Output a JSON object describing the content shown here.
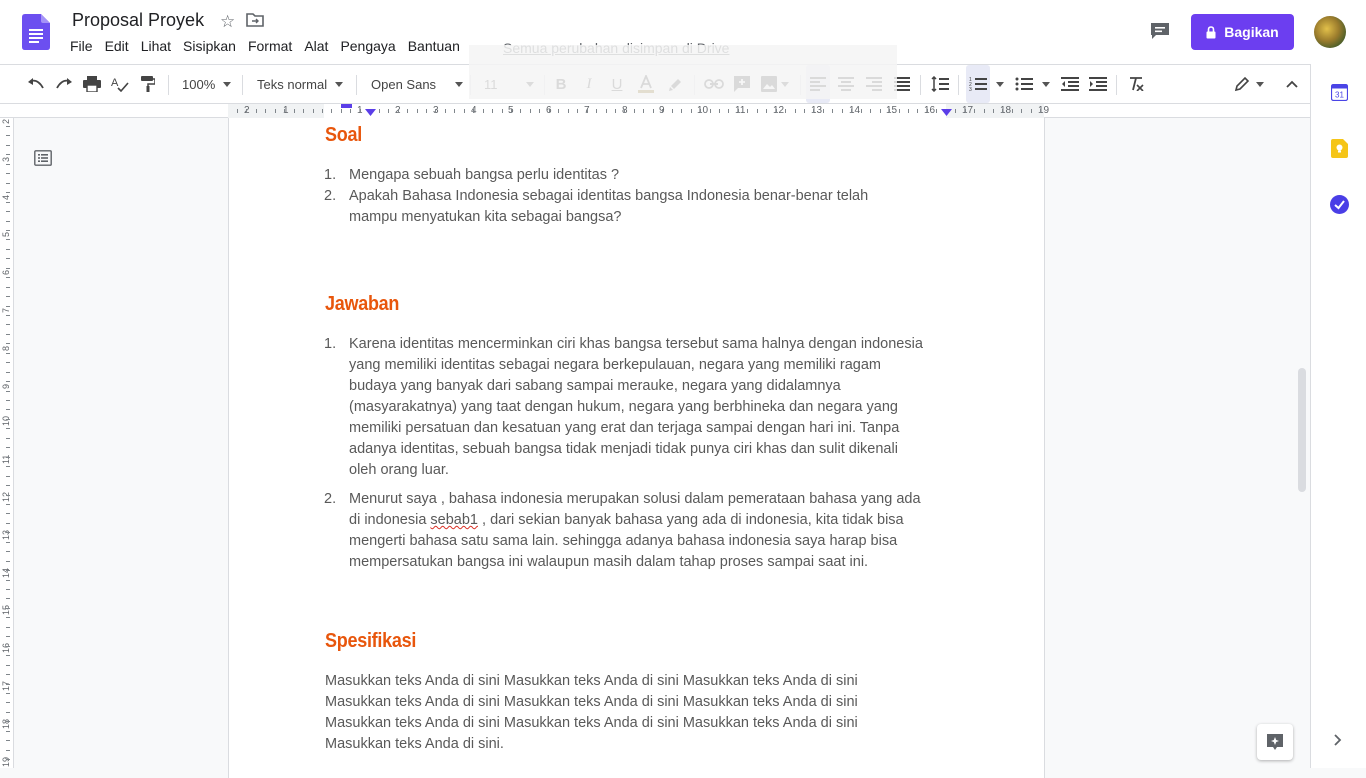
{
  "header": {
    "doc_title": "Proposal Proyek",
    "menu": [
      "File",
      "Edit",
      "Lihat",
      "Sisipkan",
      "Format",
      "Alat",
      "Pengaya",
      "Bantuan"
    ],
    "save_status": "Semua perubahan disimpan di Drive",
    "share_label": "Bagikan"
  },
  "toolbar": {
    "zoom": "100%",
    "style": "Teks normal",
    "font": "Open Sans",
    "size": "11"
  },
  "ruler": {
    "numbers": [
      "2",
      "1",
      "1",
      "2",
      "3",
      "4",
      "5",
      "6",
      "7",
      "8",
      "9",
      "10",
      "11",
      "12",
      "13",
      "14",
      "15",
      "16",
      "17",
      "18",
      "19"
    ]
  },
  "vruler": {
    "numbers": [
      "2",
      "3",
      "4",
      "5",
      "6",
      "7",
      "8",
      "9",
      "10",
      "11",
      "12",
      "13",
      "14",
      "15",
      "16",
      "17",
      "18",
      "19"
    ]
  },
  "document": {
    "soal_heading": "Soal",
    "soal_items": [
      {
        "num": "1.",
        "text": "Mengapa sebuah bangsa perlu identitas ?"
      },
      {
        "num": "2.",
        "text": "Apakah Bahasa Indonesia sebagai identitas bangsa Indonesia benar-benar telah mampu menyatukan kita sebagai bangsa?"
      }
    ],
    "jawaban_heading": "Jawaban",
    "jawaban_items": [
      {
        "num": "1.",
        "text": "Karena identitas mencerminkan ciri khas bangsa tersebut sama halnya dengan indonesia yang memiliki identitas sebagai negara berkepulauan, negara yang memiliki ragam budaya yang banyak dari sabang sampai merauke, negara yang didalamnya (masyarakatnya) yang taat dengan hukum, negara yang berbhineka dan negara yang memiliki persatuan dan kesatuan yang erat dan terjaga sampai dengan hari ini. Tanpa adanya identitas, sebuah bangsa tidak menjadi tidak punya ciri khas dan sulit dikenali oleh orang luar."
      },
      {
        "num": "2.",
        "text_before": "Menurut saya , bahasa indonesia merupakan solusi dalam pemerataan bahasa yang ada di indonesia ",
        "text_spell": "sebab1",
        "text_after": "  , dari sekian banyak bahasa yang ada di indonesia, kita tidak bisa mengerti bahasa satu sama lain. sehingga adanya bahasa indonesia saya harap bisa mempersatukan bangsa ini walaupun masih dalam tahap proses sampai saat ini."
      }
    ],
    "spesifikasi_heading": "Spesifikasi",
    "spesifikasi_text": "Masukkan teks Anda di sini Masukkan teks Anda di sini Masukkan teks Anda di sini Masukkan teks Anda di sini Masukkan teks Anda di sini Masukkan teks Anda di sini Masukkan teks Anda di sini Masukkan teks Anda di sini Masukkan teks Anda di sini Masukkan teks Anda di sini."
  },
  "colors": {
    "accent": "#6c3ef0",
    "heading": "#e8560c",
    "body_text": "#595959"
  }
}
